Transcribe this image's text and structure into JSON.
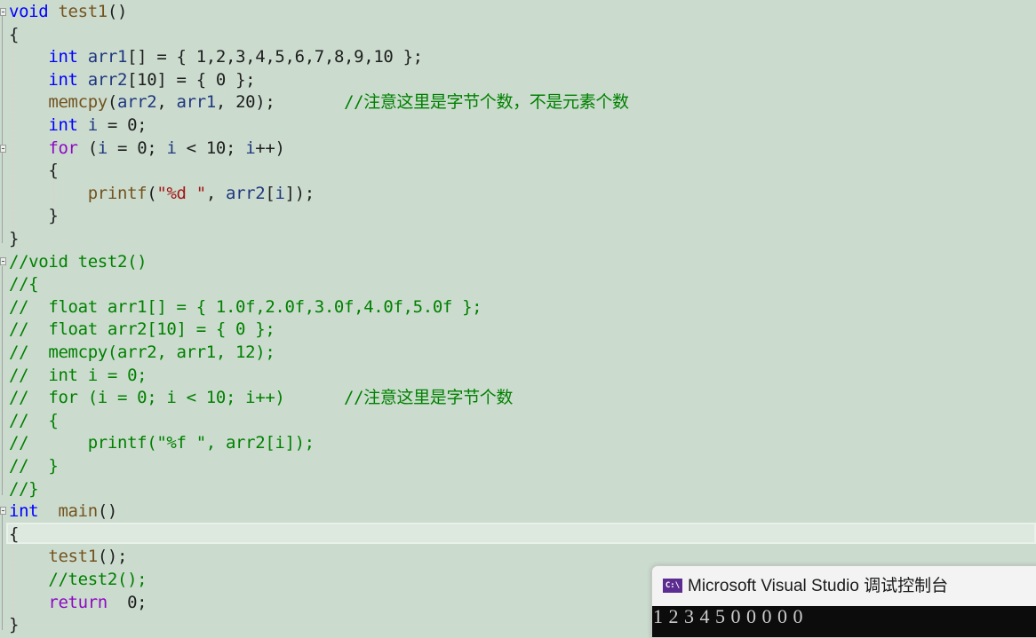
{
  "editor": {
    "lines": [
      {
        "segments": [
          [
            "kw",
            "void"
          ],
          [
            "txt",
            " "
          ],
          [
            "fn",
            "test1"
          ],
          [
            "txt",
            "()"
          ]
        ]
      },
      {
        "segments": [
          [
            "txt",
            "{"
          ]
        ]
      },
      {
        "segments": [
          [
            "txt",
            "    "
          ],
          [
            "kw",
            "int"
          ],
          [
            "txt",
            " "
          ],
          [
            "var",
            "arr1"
          ],
          [
            "txt",
            "[] = { 1,2,3,4,5,6,7,8,9,10 };"
          ]
        ]
      },
      {
        "segments": [
          [
            "txt",
            "    "
          ],
          [
            "kw",
            "int"
          ],
          [
            "txt",
            " "
          ],
          [
            "var",
            "arr2"
          ],
          [
            "txt",
            "[10] = { 0 };"
          ]
        ]
      },
      {
        "segments": [
          [
            "txt",
            "    "
          ],
          [
            "fn",
            "memcpy"
          ],
          [
            "txt",
            "("
          ],
          [
            "var",
            "arr2"
          ],
          [
            "txt",
            ", "
          ],
          [
            "var",
            "arr1"
          ],
          [
            "txt",
            ", 20);       "
          ],
          [
            "cm",
            "//注意这里是字节个数，不是元素个数"
          ]
        ]
      },
      {
        "segments": [
          [
            "txt",
            "    "
          ],
          [
            "kw",
            "int"
          ],
          [
            "txt",
            " "
          ],
          [
            "var",
            "i"
          ],
          [
            "txt",
            " = 0;"
          ]
        ]
      },
      {
        "segments": [
          [
            "txt",
            "    "
          ],
          [
            "ctl",
            "for"
          ],
          [
            "txt",
            " ("
          ],
          [
            "var",
            "i"
          ],
          [
            "txt",
            " = 0; "
          ],
          [
            "var",
            "i"
          ],
          [
            "txt",
            " < 10; "
          ],
          [
            "var",
            "i"
          ],
          [
            "txt",
            "++)"
          ]
        ]
      },
      {
        "segments": [
          [
            "txt",
            "    {"
          ]
        ]
      },
      {
        "segments": [
          [
            "txt",
            "        "
          ],
          [
            "fn",
            "printf"
          ],
          [
            "txt",
            "("
          ],
          [
            "str",
            "\"%d \""
          ],
          [
            "txt",
            ", "
          ],
          [
            "var",
            "arr2"
          ],
          [
            "txt",
            "["
          ],
          [
            "var",
            "i"
          ],
          [
            "txt",
            "]);"
          ]
        ]
      },
      {
        "segments": [
          [
            "txt",
            "    }"
          ]
        ]
      },
      {
        "segments": [
          [
            "txt",
            "}"
          ]
        ]
      },
      {
        "segments": [
          [
            "cm",
            "//void test2()"
          ]
        ]
      },
      {
        "segments": [
          [
            "cm",
            "//{"
          ]
        ]
      },
      {
        "segments": [
          [
            "cm",
            "//  float arr1[] = { 1.0f,2.0f,3.0f,4.0f,5.0f };"
          ]
        ]
      },
      {
        "segments": [
          [
            "cm",
            "//  float arr2[10] = { 0 };"
          ]
        ]
      },
      {
        "segments": [
          [
            "cm",
            "//  memcpy(arr2, arr1, 12);"
          ]
        ]
      },
      {
        "segments": [
          [
            "cm",
            "//  int i = 0;"
          ]
        ]
      },
      {
        "segments": [
          [
            "cm",
            "//  for (i = 0; i < 10; i++)      //注意这里是字节个数"
          ]
        ]
      },
      {
        "segments": [
          [
            "cm",
            "//  {"
          ]
        ]
      },
      {
        "segments": [
          [
            "cm",
            "//      printf(\"%f \", arr2[i]);"
          ]
        ]
      },
      {
        "segments": [
          [
            "cm",
            "//  }"
          ]
        ]
      },
      {
        "segments": [
          [
            "cm",
            "//}"
          ]
        ]
      },
      {
        "segments": [
          [
            "kw",
            "int"
          ],
          [
            "txt",
            "  "
          ],
          [
            "fn",
            "main"
          ],
          [
            "txt",
            "()"
          ]
        ]
      },
      {
        "segments": [
          [
            "txt",
            "{"
          ]
        ]
      },
      {
        "segments": [
          [
            "txt",
            "    "
          ],
          [
            "fn",
            "test1"
          ],
          [
            "txt",
            "();"
          ]
        ]
      },
      {
        "segments": [
          [
            "txt",
            "    "
          ],
          [
            "cm",
            "//test2();"
          ]
        ]
      },
      {
        "segments": [
          [
            "txt",
            "    "
          ],
          [
            "ctl",
            "return"
          ],
          [
            "txt",
            "  0;"
          ]
        ]
      },
      {
        "segments": [
          [
            "txt",
            "}"
          ]
        ]
      }
    ]
  },
  "console": {
    "icon": "C:\\",
    "title": "Microsoft Visual Studio 调试控制台",
    "output": "1 2 3 4 5 0 0 0 0 0"
  }
}
